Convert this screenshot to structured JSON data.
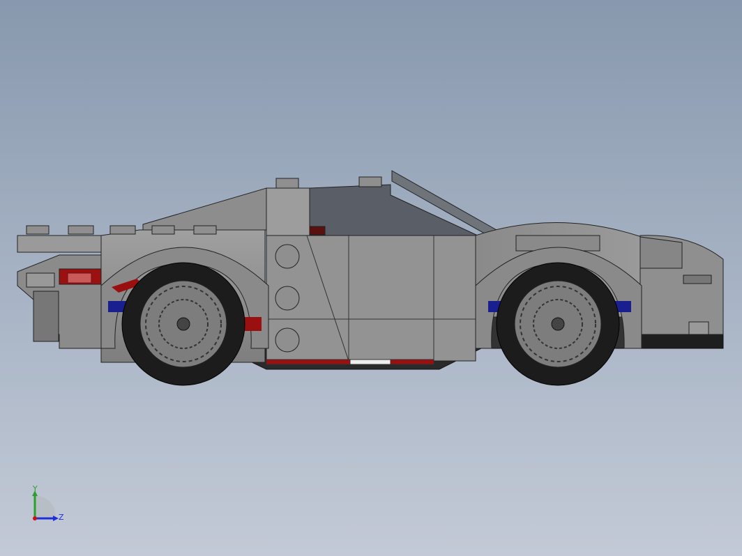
{
  "viewport": {
    "background_top": "#8898ad",
    "background_bottom": "#c3cad6"
  },
  "model": {
    "subject": "lego-sports-car-side-view",
    "body_color": "#8c8c8c",
    "stripe_colors": [
      "#9a1010",
      "#f0f0f0",
      "#1a1f8f"
    ],
    "tire_color": "#1c1c1c",
    "rim_color": "#7d7d7d",
    "windshield_color": "#5a5e66"
  },
  "triad": {
    "y_label": "Y",
    "z_label": "Z",
    "y_color": "#2ca02c",
    "z_color": "#1f2fd8",
    "origin_color": "#d01010"
  }
}
